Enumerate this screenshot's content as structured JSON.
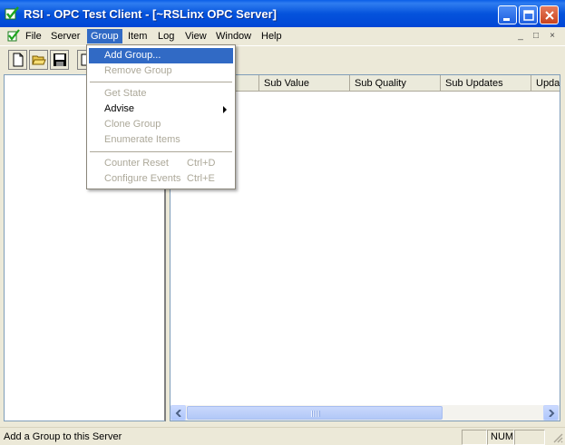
{
  "window": {
    "title": "RSI - OPC Test Client - [~RSLinx OPC Server]",
    "icon": "check-icon"
  },
  "menubar": {
    "items": [
      "File",
      "Server",
      "Group",
      "Item",
      "Log",
      "View",
      "Window",
      "Help"
    ],
    "active": "Group",
    "mdi_controls": [
      "_",
      "□",
      "×"
    ]
  },
  "toolbar": {
    "buttons": [
      "new-file-icon",
      "open-folder-icon",
      "save-disk-icon",
      "properties-icon"
    ]
  },
  "list": {
    "columns": [
      "",
      "Sub Value",
      "Sub Quality",
      "Sub Updates",
      "Upda"
    ]
  },
  "group_menu": {
    "items": [
      {
        "label": "Add Group...",
        "enabled": true,
        "highlighted": true
      },
      {
        "label": "Remove Group",
        "enabled": false
      },
      {
        "label": "Get State",
        "enabled": false
      },
      {
        "label": "Advise",
        "enabled": true,
        "submenu": true
      },
      {
        "label": "Clone Group",
        "enabled": false
      },
      {
        "label": "Enumerate Items",
        "enabled": false
      },
      {
        "label": "Counter Reset",
        "enabled": false,
        "shortcut": "Ctrl+D"
      },
      {
        "label": "Configure Events",
        "enabled": false,
        "shortcut": "Ctrl+E"
      }
    ]
  },
  "statusbar": {
    "message": "Add a Group to this Server",
    "num": "NUM"
  },
  "colors": {
    "title_bar": "#0054e3",
    "menu_highlight": "#316ac5",
    "disabled_text": "#aca899",
    "window_bg": "#ece9d8"
  }
}
